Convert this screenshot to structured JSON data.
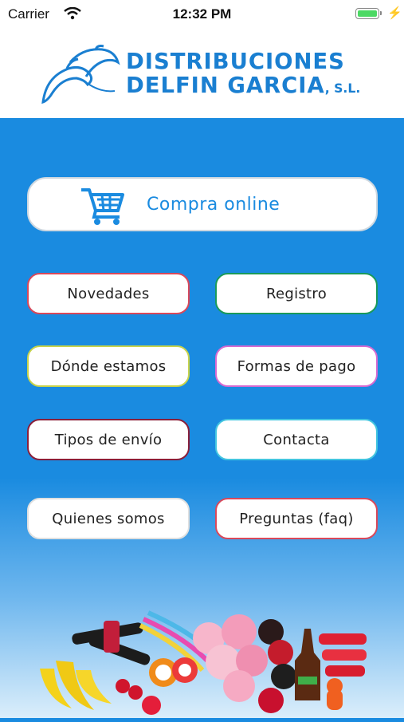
{
  "status_bar": {
    "carrier": "Carrier",
    "time": "12:32 PM"
  },
  "logo": {
    "line1": "DISTRIBUCIONES",
    "line2": "DELFIN GARCIA",
    "suffix": ", S.L.",
    "icon": "dolphins-icon"
  },
  "primary_button": {
    "label": "Compra online",
    "icon": "shopping-cart-icon"
  },
  "menu": [
    {
      "label": "Novedades",
      "border": "#d9485a"
    },
    {
      "label": "Registro",
      "border": "#1a9a5a"
    },
    {
      "label": "Dónde estamos",
      "border": "#c8d34a"
    },
    {
      "label": "Formas de pago",
      "border": "#d66ad1"
    },
    {
      "label": "Tipos de envío",
      "border": "#8a1f3a"
    },
    {
      "label": "Contacta",
      "border": "#43c5e0"
    },
    {
      "label": "Quienes somos",
      "border": "#e0e0e0"
    },
    {
      "label": "Preguntas (faq)",
      "border": "#d9485a"
    }
  ],
  "colors": {
    "brand": "#1a7fd1",
    "background": "#1a8be0"
  }
}
